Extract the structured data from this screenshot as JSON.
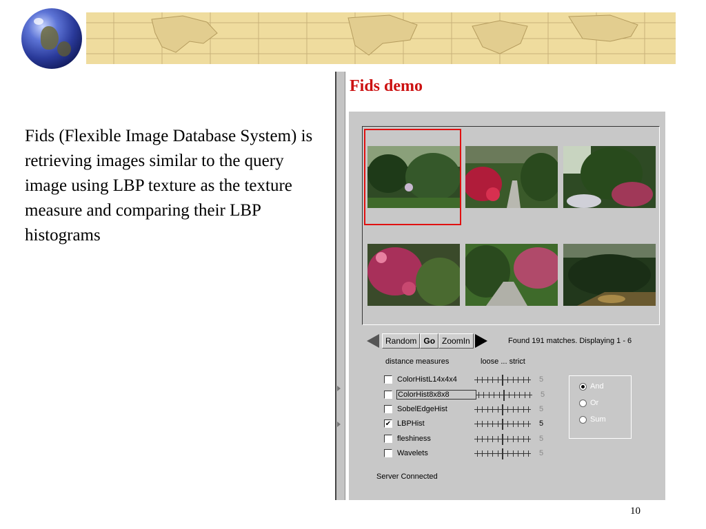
{
  "slide": {
    "title": "Fids demo",
    "description": "Fids (Flexible Image Database System) is retrieving images similar to the query image using LBP texture as the texture measure and comparing their LBP histograms",
    "page_number": "10"
  },
  "applet": {
    "nav": {
      "random_label": "Random",
      "go_label": "Go",
      "zoomin_label": "ZoomIn"
    },
    "status_text": "Found 191 matches.  Displaying 1 - 6",
    "header_measures": "distance measures",
    "header_scale": "loose ... strict",
    "measures": [
      {
        "label": "ColorHistL14x4x4",
        "checked": false,
        "value": "5"
      },
      {
        "label": "ColorHist8x8x8",
        "checked": false,
        "value": "5"
      },
      {
        "label": "SobelEdgeHist",
        "checked": false,
        "value": "5"
      },
      {
        "label": "LBPHist",
        "checked": true,
        "value": "5"
      },
      {
        "label": "fleshiness",
        "checked": false,
        "value": "5"
      },
      {
        "label": "Wavelets",
        "checked": false,
        "value": "5"
      }
    ],
    "combine": [
      {
        "label": "And",
        "selected": true
      },
      {
        "label": "Or",
        "selected": false
      },
      {
        "label": "Sum",
        "selected": false
      }
    ],
    "server_status": "Server Connected"
  },
  "colors": {
    "title": "#cc1111",
    "selection": "#e01010",
    "applet_bg": "#c8c8c8"
  }
}
